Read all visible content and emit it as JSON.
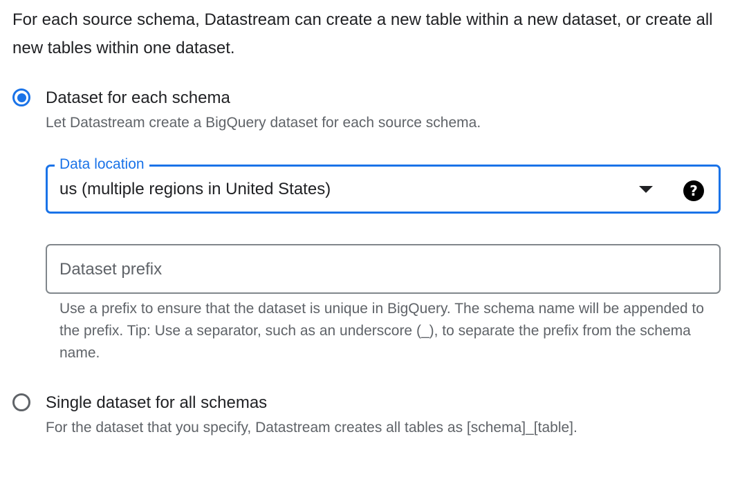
{
  "intro": {
    "text": "For each source schema, Datastream can create a new table within a new dataset, or create all new tables within one dataset."
  },
  "options": [
    {
      "label": "Dataset for each schema",
      "description": "Let Datastream create a BigQuery dataset for each source schema.",
      "selected": true
    },
    {
      "label": "Single dataset for all schemas",
      "description": "For the dataset that you specify, Datastream creates all tables as [schema]_[table].",
      "selected": false
    }
  ],
  "data_location": {
    "label": "Data location",
    "value": "us (multiple regions in United States)",
    "help_icon": "help-icon",
    "dropdown_icon": "dropdown-arrow-icon"
  },
  "dataset_prefix": {
    "placeholder": "Dataset prefix",
    "value": "",
    "helper": "Use a prefix to ensure that the dataset is unique in BigQuery. The schema name will be appended to the prefix. Tip: Use a separator, such as an underscore (_), to separate the prefix from the schema name."
  },
  "colors": {
    "accent": "#1a73e8",
    "text": "#202124",
    "secondary_text": "#5f6368",
    "border": "#80868b"
  }
}
